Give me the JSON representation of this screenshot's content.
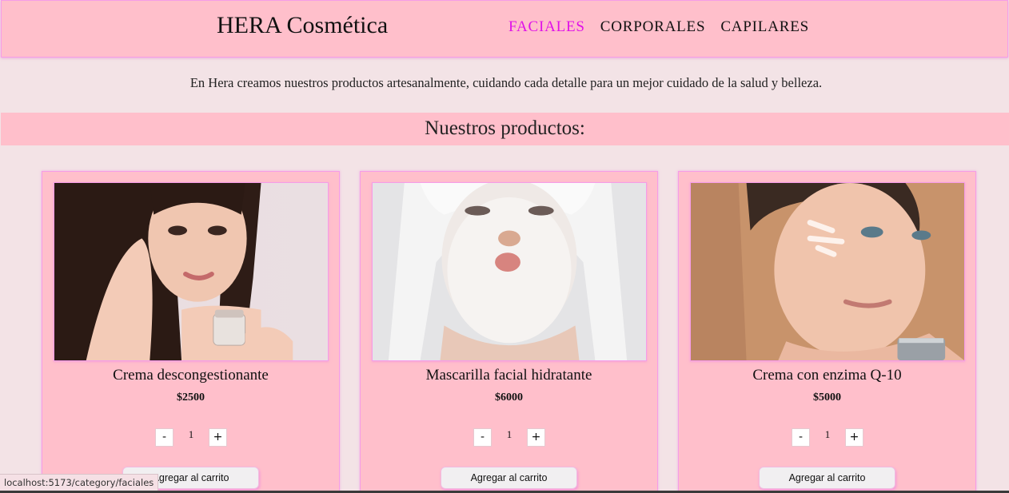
{
  "header": {
    "brand": "HERA Cosmética",
    "nav": [
      {
        "label": "FACIALES",
        "active": true
      },
      {
        "label": "CORPORALES",
        "active": false
      },
      {
        "label": "CAPILARES",
        "active": false
      }
    ],
    "active_color": "#e011e8"
  },
  "intro": {
    "text": "En Hera creamos nuestros productos artesanalmente, cuidando cada detalle para un mejor cuidado de la salud y belleza."
  },
  "products_section": {
    "title": "Nuestros productos:"
  },
  "products": [
    {
      "name": "Crema descongestionante",
      "price": "$2500",
      "quantity": "1",
      "minus_label": "-",
      "plus_label": "+",
      "add_label": "Agregar al carrito",
      "image": "woman-applying-cream"
    },
    {
      "name": "Mascarilla facial hidratante",
      "price": "$6000",
      "quantity": "1",
      "minus_label": "-",
      "plus_label": "+",
      "add_label": "Agregar al carrito",
      "image": "woman-with-face-mask"
    },
    {
      "name": "Crema con enzima Q-10",
      "price": "$5000",
      "quantity": "1",
      "minus_label": "-",
      "plus_label": "+",
      "add_label": "Agregar al carrito",
      "image": "woman-with-cream-on-cheek"
    }
  ],
  "status_bar": {
    "url": "localhost:5173/category/faciales"
  },
  "colors": {
    "page_bg": "#f3e3e6",
    "header_bg": "#ffbfcb",
    "border": "#f59ce8"
  }
}
